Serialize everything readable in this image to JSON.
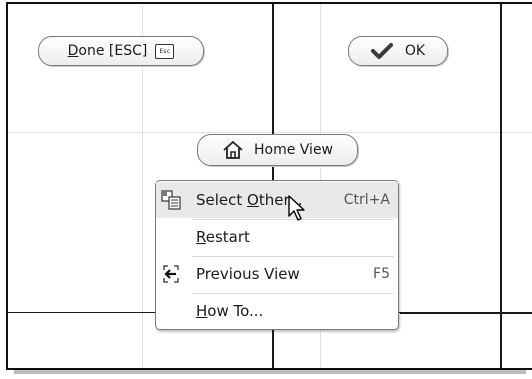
{
  "toolbar": {
    "done": {
      "mnemonic": "D",
      "rest": "one [ESC]",
      "key_icon": "esc-key-icon",
      "key_text": "Esc"
    },
    "ok": {
      "label": "OK",
      "icon": "checkmark-icon"
    },
    "home_view": {
      "label": "Home View",
      "icon": "home-icon"
    }
  },
  "context_menu": {
    "items": [
      {
        "pre": "Select ",
        "mnemonic": "O",
        "post": "ther...",
        "shortcut": "Ctrl+A",
        "icon": "select-other-icon"
      },
      {
        "pre": "",
        "mnemonic": "R",
        "post": "estart",
        "shortcut": "",
        "icon": ""
      },
      {
        "pre": "Previous View",
        "mnemonic": "",
        "post": "",
        "shortcut": "F5",
        "icon": "previous-view-icon"
      },
      {
        "pre": "",
        "mnemonic": "H",
        "post": "ow To...",
        "shortcut": "",
        "icon": ""
      }
    ]
  },
  "colors": {
    "grid_thin": "#e0e0e0",
    "grid_thick": "#1a1a1a",
    "menu_highlight": "#e9e9e9",
    "check_green": "#3a3a3a"
  }
}
